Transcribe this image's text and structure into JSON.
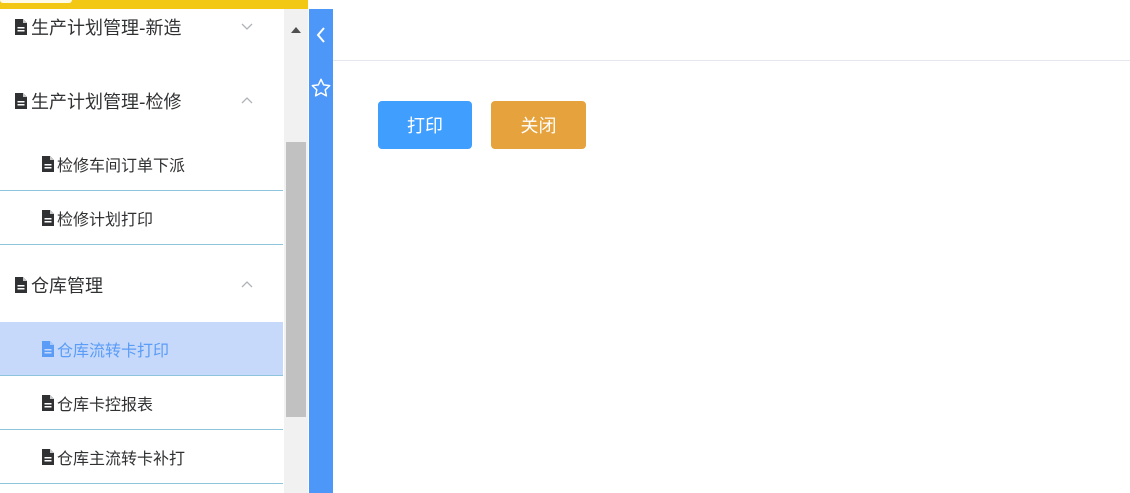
{
  "sidebar": {
    "groups": [
      {
        "label": "生产计划管理-新造",
        "icon": "doc-icon",
        "expanded": false
      },
      {
        "label": "生产计划管理-检修",
        "icon": "doc-icon",
        "expanded": true
      },
      {
        "label": "仓库管理",
        "icon": "doc-icon",
        "expanded": true
      }
    ],
    "items": [
      {
        "label": "检修车间订单下派",
        "active": false
      },
      {
        "label": "检修计划打印",
        "active": false
      },
      {
        "label": "仓库流转卡打印",
        "active": true
      },
      {
        "label": "仓库卡控报表",
        "active": false
      },
      {
        "label": "仓库主流转卡补打",
        "active": false
      }
    ]
  },
  "rail": {
    "collapse_icon": "chevron-left-icon",
    "favorite_icon": "star-outline-icon"
  },
  "toolbar": {
    "print_label": "打印",
    "close_label": "关闭"
  },
  "colors": {
    "top_strip": "#f2c814",
    "rail": "#4d97f8",
    "active_item_bg": "#c6d9fb",
    "active_item_text": "#5a9cf6",
    "print_button": "#409eff",
    "close_button": "#e6a23c"
  }
}
